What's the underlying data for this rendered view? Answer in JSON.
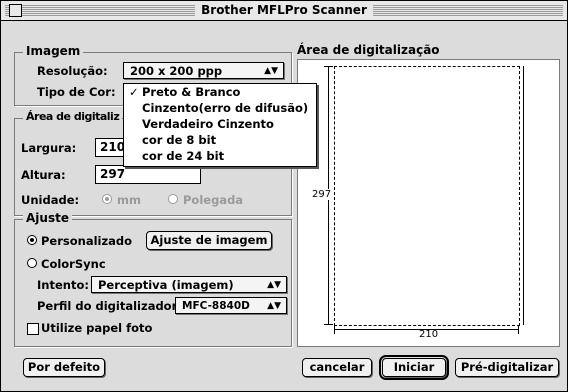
{
  "window": {
    "title": "Brother MFLPro Scanner"
  },
  "imagem": {
    "legend": "Imagem",
    "resolucao_label": "Resolução:",
    "resolucao_value": "200 x 200 ppp",
    "tipo_cor_label": "Tipo de Cor:"
  },
  "color_menu": {
    "items": [
      {
        "label": "Preto & Branco",
        "checked": "✓"
      },
      {
        "label": "Cinzento(erro de difusão)"
      },
      {
        "label": "Verdadeiro Cinzento"
      },
      {
        "label": "cor de 8 bit"
      },
      {
        "label": "cor de 24 bit"
      }
    ]
  },
  "area": {
    "legend": "Área de digitaliz",
    "largura_label": "Largura:",
    "largura_value": "210",
    "altura_label": "Altura:",
    "altura_value": "297",
    "unidade_label": "Unidade:",
    "unit_mm": "mm",
    "unit_polegada": "Polegada",
    "selected_unit": "mm"
  },
  "ajuste": {
    "legend": "Ajuste",
    "personalizado": "Personalizado",
    "ajuste_button": "Ajuste de imagem",
    "colorsync": "ColorSync",
    "intento_label": "Intento:",
    "intento_value": "Perceptiva (imagem)",
    "perfil_label": "Perfil do digitalizador:",
    "perfil_value": "MFC-8840D",
    "papel_foto": "Utilize papel foto",
    "selected": "Personalizado"
  },
  "scan_area": {
    "legend": "Área de digitalização",
    "height_label": "297",
    "width_label": "210"
  },
  "buttons": {
    "por_defeito": "Por defeito",
    "cancelar": "cancelar",
    "iniciar": "Iniciar",
    "pre_digitalizar": "Pré-digitalizar"
  }
}
